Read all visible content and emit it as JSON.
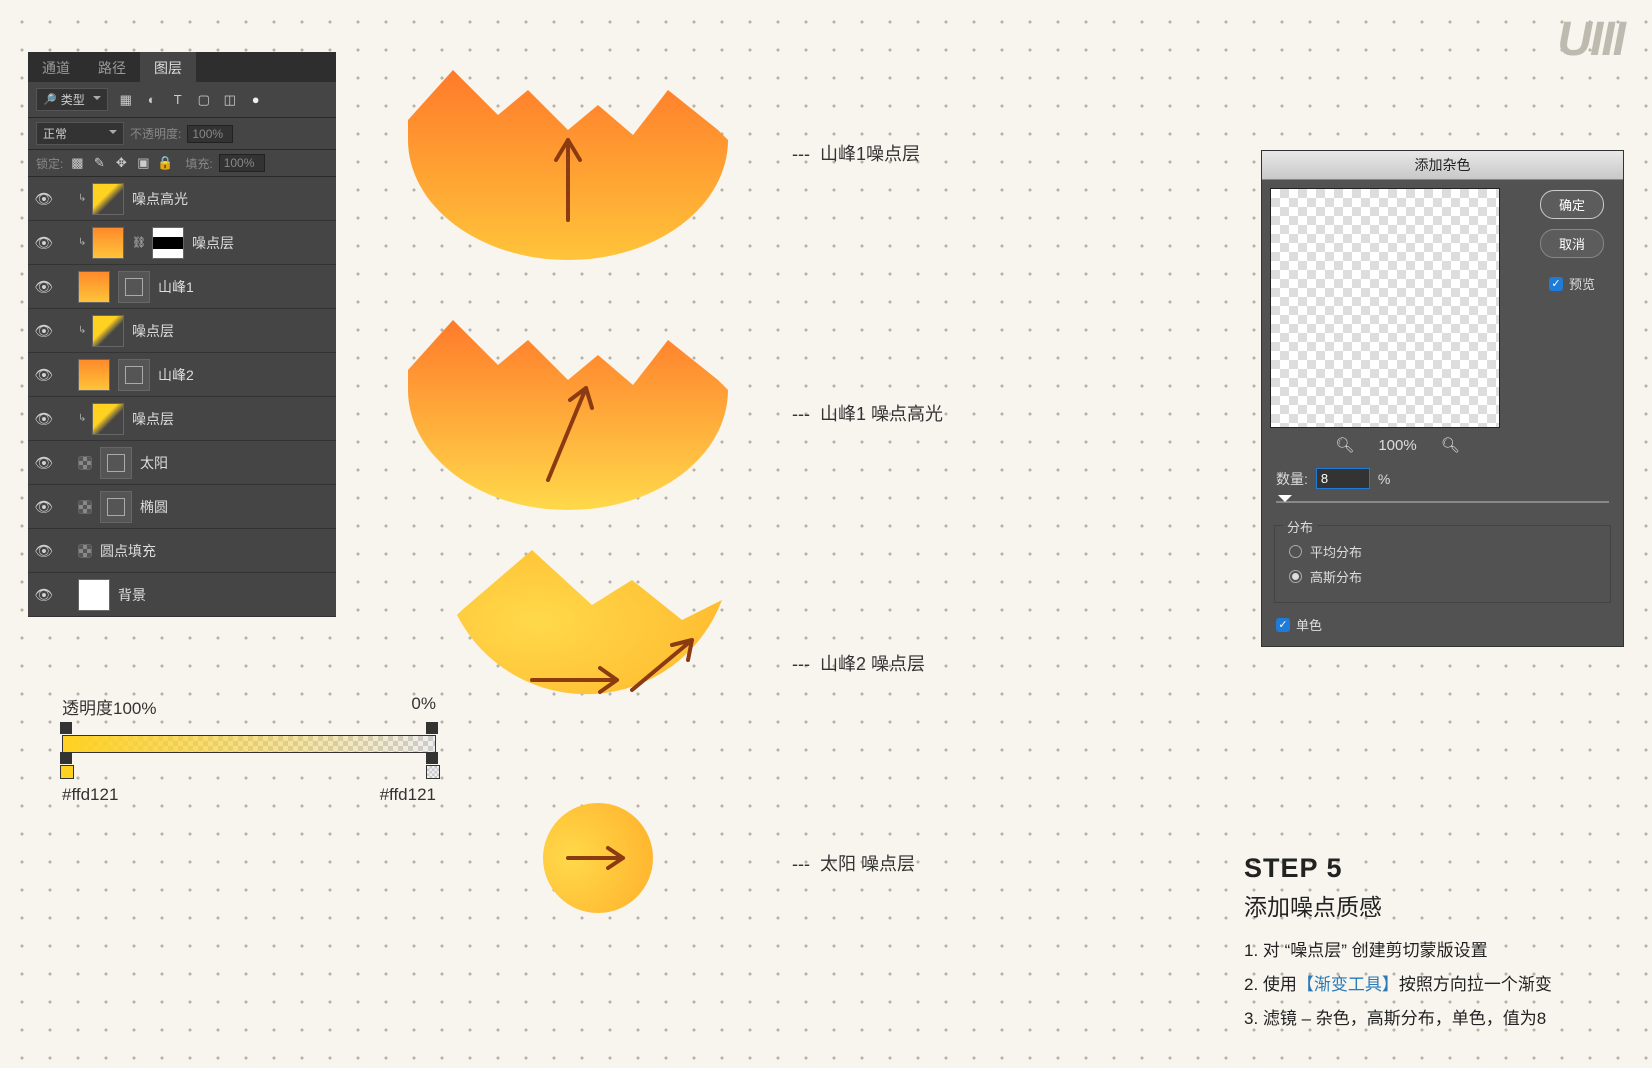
{
  "logo": "UIII",
  "layers_panel": {
    "tabs": {
      "channels": "通道",
      "paths": "路径",
      "layers": "图层"
    },
    "filter_label": "类型",
    "blend_mode": "正常",
    "opacity_label": "不透明度:",
    "opacity_value": "100%",
    "lock_label": "锁定:",
    "fill_label": "填充:",
    "fill_value": "100%",
    "items": [
      {
        "name": "噪点高光"
      },
      {
        "name": "噪点层"
      },
      {
        "name": "山峰1"
      },
      {
        "name": "噪点层"
      },
      {
        "name": "山峰2"
      },
      {
        "name": "噪点层"
      },
      {
        "name": "太阳"
      },
      {
        "name": "椭圆"
      },
      {
        "name": "圆点填充"
      },
      {
        "name": "背景"
      }
    ]
  },
  "gradient": {
    "left_label": "透明度100%",
    "right_label": "0%",
    "color_left": "#ffd121",
    "color_right": "#ffd121"
  },
  "illustrations": {
    "dash": "---",
    "label1": "山峰1噪点层",
    "label2": "山峰1 噪点高光",
    "label3": "山峰2 噪点层",
    "label4": "太阳 噪点层"
  },
  "dialog": {
    "title": "添加杂色",
    "ok": "确定",
    "cancel": "取消",
    "preview_label": "预览",
    "zoom_pct": "100%",
    "amount_label": "数量:",
    "amount_value": "8",
    "amount_unit": "%",
    "dist_label": "分布",
    "dist_uniform": "平均分布",
    "dist_gaussian": "高斯分布",
    "mono_label": "单色"
  },
  "step": {
    "num": "STEP 5",
    "title": "添加噪点质感",
    "li1_a": "1. 对 “噪点层” 创建剪切蒙版设置",
    "li2_a": "2. 使用",
    "li2_hl": "【渐变工具】",
    "li2_b": "按照方向拉一个渐变",
    "li3_a": "3. 滤镜 – 杂色，高斯分布，单色，值为8"
  }
}
